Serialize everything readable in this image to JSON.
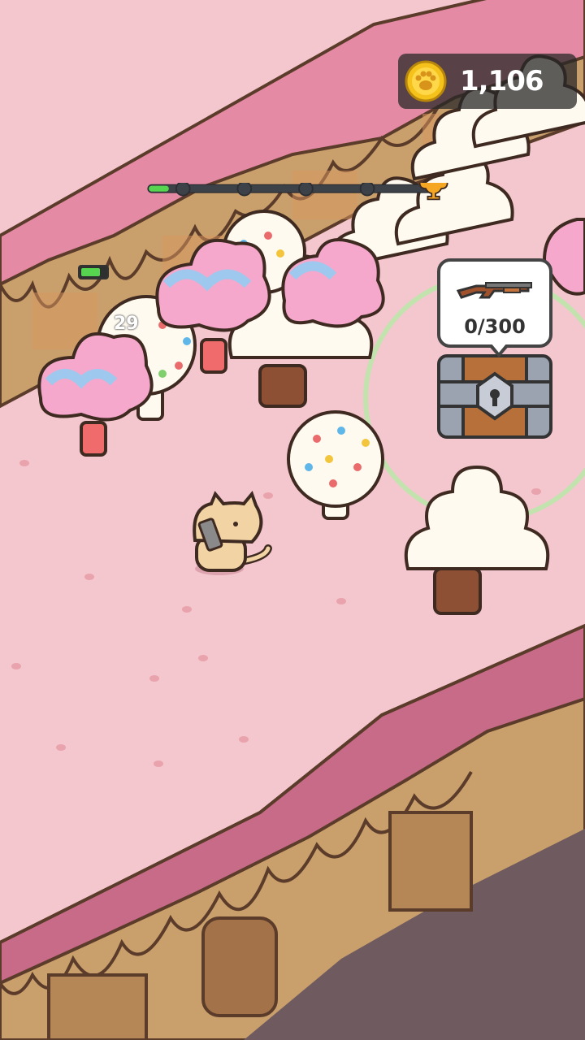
{
  "hud": {
    "coins": "1,106",
    "coin_icon": "paw-coin-icon",
    "level_progress": {
      "fraction": 0.07,
      "checkpoints": 4,
      "goal_icon": "trophy-icon"
    }
  },
  "chest": {
    "reward_icon": "shotgun-icon",
    "progress": "0/300"
  },
  "enemy": {
    "level": "29",
    "health_fraction": 0.75
  },
  "colors": {
    "ground": "#f4c7cf",
    "frosting": "#e58aa4",
    "frosting_dark": "#c06c84",
    "waffle": "#c99f6b",
    "progress_fill": "#56d44f",
    "coin": "#f5c21b"
  }
}
